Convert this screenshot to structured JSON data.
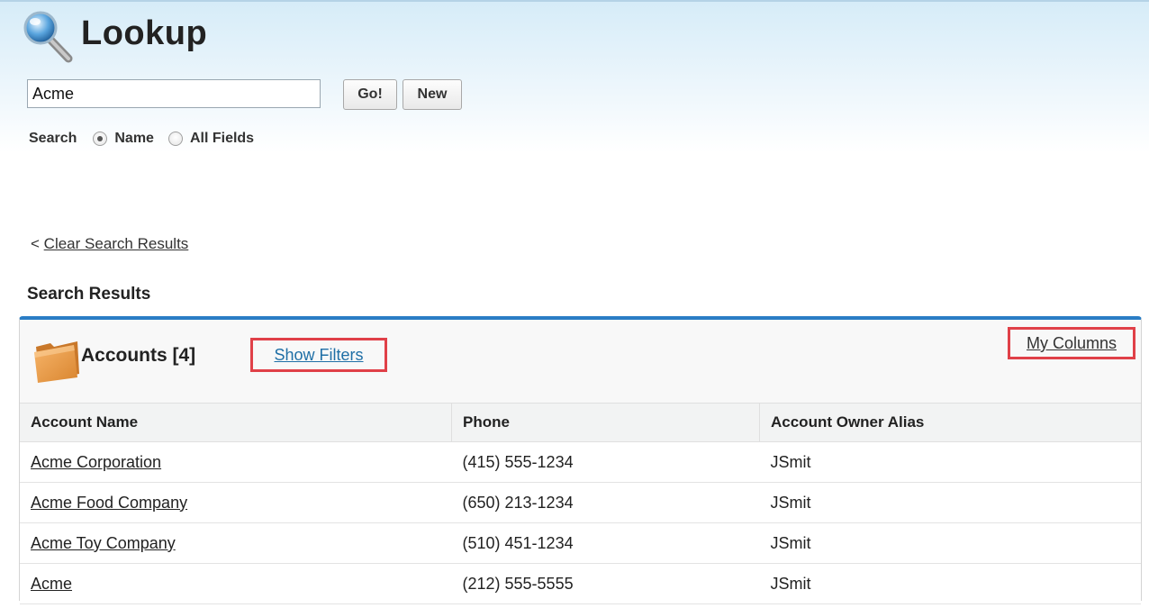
{
  "header": {
    "title": "Lookup",
    "search_value": "Acme",
    "go_label": "Go!",
    "new_label": "New",
    "scope_label": "Search",
    "scope_options": [
      "Name",
      "All Fields"
    ],
    "scope_selected": "Name"
  },
  "clear": {
    "prefix": "<",
    "link_label": "Clear Search Results"
  },
  "results": {
    "heading": "Search Results",
    "panel_title": "Accounts [4]",
    "show_filters_label": "Show Filters",
    "my_columns_label": "My Columns",
    "columns": [
      "Account Name",
      "Phone",
      "Account Owner Alias"
    ],
    "rows": [
      {
        "name": "Acme Corporation",
        "phone": "(415) 555-1234",
        "owner": "JSmit"
      },
      {
        "name": "Acme Food Company",
        "phone": "(650) 213-1234",
        "owner": "JSmit"
      },
      {
        "name": "Acme Toy Company",
        "phone": "(510) 451-1234",
        "owner": "JSmit"
      },
      {
        "name": "Acme",
        "phone": "(212) 555-5555",
        "owner": "JSmit"
      }
    ]
  },
  "colors": {
    "accent": "#2a7dc5",
    "highlight_box": "#e04048",
    "link_blue": "#1f6fa6"
  },
  "icons": [
    "magnifier-icon",
    "folder-icon"
  ]
}
